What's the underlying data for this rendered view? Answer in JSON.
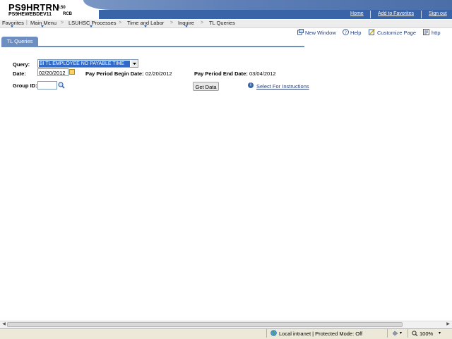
{
  "header": {
    "title": "PS9HRTRN",
    "version": "8.50",
    "database": "PS9HEWEBDEV11",
    "user": "RCB",
    "links": [
      {
        "label": "Home"
      },
      {
        "label": "Add to Favorites"
      },
      {
        "label": "Sign out"
      }
    ]
  },
  "menu": {
    "items": [
      {
        "label": "Favorites"
      },
      {
        "label": "Main Menu"
      },
      {
        "label": "LSUHSC Processes"
      },
      {
        "label": "Time and Labor"
      },
      {
        "label": "Inquire"
      },
      {
        "label": "TL Queries"
      }
    ],
    "separator": ">"
  },
  "toolbar": {
    "new_window": "New Window",
    "help": "Help",
    "customize_page": "Customize Page",
    "http": "http"
  },
  "tab": {
    "label": "TL Queries"
  },
  "form": {
    "query_label": "Query:",
    "query_value": "BI TL EMPLOYEE NO PAYABLE TIME",
    "date_label": "Date:",
    "date_value": "02/20/2012",
    "begin_label": "Pay Period Begin Date:",
    "begin_value": "02/20/2012",
    "end_label": "Pay Period End Date:",
    "end_value": "03/04/2012",
    "group_label": "Group ID:",
    "group_value": "",
    "get_data": "Get Data",
    "instructions": "Select For Instructions"
  },
  "status": {
    "zone": "Local intranet | Protected Mode: Off",
    "zoom": "100%"
  },
  "colors": {
    "header_blue": "#3a64a8",
    "tab_blue": "#6d8ec0",
    "selection_blue": "#3169c6"
  }
}
